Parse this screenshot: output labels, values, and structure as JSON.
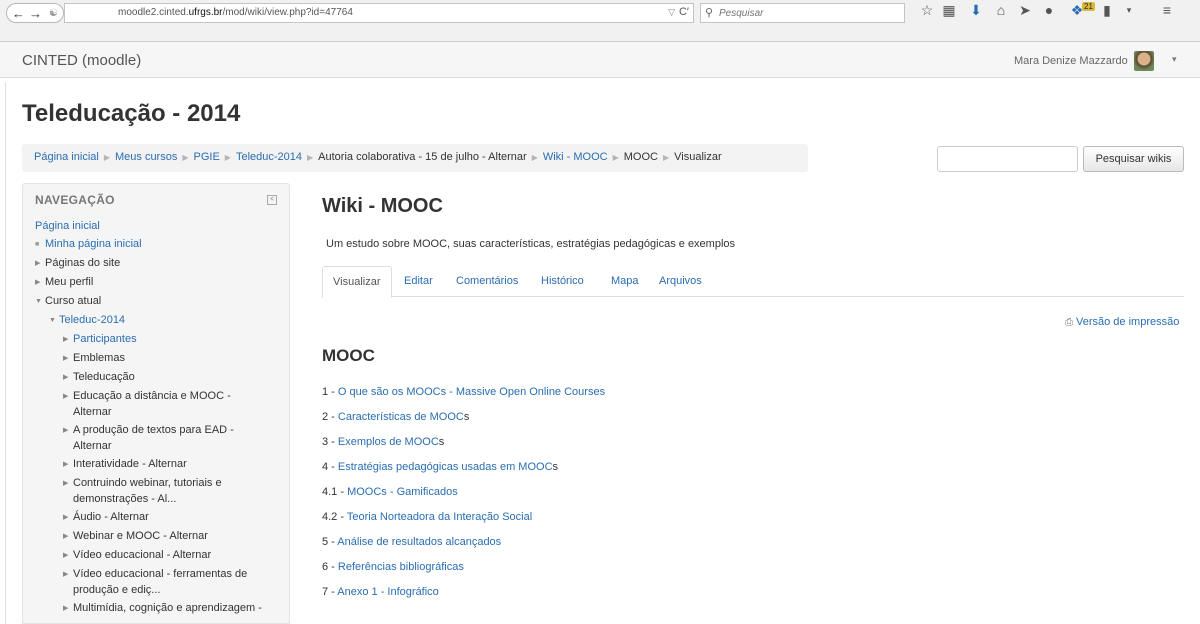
{
  "browser": {
    "url_prefix": "moodle2.cinted.",
    "url_domain": "ufrgs.br",
    "url_path": "/mod/wiki/view.php?id=47764",
    "search_placeholder": "Pesquisar",
    "notification_count": "21"
  },
  "header": {
    "site_name": "CINTED (moodle)",
    "user_name": "Mara Denize Mazzardo"
  },
  "page": {
    "title": "Teleducação - 2014"
  },
  "breadcrumb": [
    {
      "label": "Página inicial",
      "link": true
    },
    {
      "label": "Meus cursos",
      "link": true
    },
    {
      "label": "PGIE",
      "link": true
    },
    {
      "label": "Teleduc-2014",
      "link": true
    },
    {
      "label": "Autoria colaborativa - 15 de julho - Alternar",
      "link": false
    },
    {
      "label": "Wiki - MOOC",
      "link": true
    },
    {
      "label": "MOOC",
      "link": false
    },
    {
      "label": "Visualizar",
      "link": false
    }
  ],
  "wiki_search": {
    "button_label": "Pesquisar wikis"
  },
  "navigation": {
    "title": "NAVEGAÇÃO",
    "items": [
      {
        "label": "Página inicial",
        "level": 0,
        "marker": "none",
        "link": true
      },
      {
        "label": "Minha página inicial",
        "level": 1,
        "marker": "dot",
        "link": true
      },
      {
        "label": "Páginas do site",
        "level": 1,
        "marker": "right",
        "link": false
      },
      {
        "label": "Meu perfil",
        "level": 1,
        "marker": "right",
        "link": false
      },
      {
        "label": "Curso atual",
        "level": 1,
        "marker": "down",
        "link": false
      },
      {
        "label": "Teleduc-2014",
        "level": 2,
        "marker": "down",
        "link": true
      },
      {
        "label": "Participantes",
        "level": 3,
        "marker": "right",
        "link": true
      },
      {
        "label": "Emblemas",
        "level": 3,
        "marker": "right",
        "link": false
      },
      {
        "label": "Teleducação",
        "level": 3,
        "marker": "right",
        "link": false
      },
      {
        "label": "Educação a distância e MOOC - Alternar",
        "level": 3,
        "marker": "right",
        "link": false
      },
      {
        "label": "A produção de textos para EAD - Alternar",
        "level": 3,
        "marker": "right",
        "link": false
      },
      {
        "label": "Interatividade - Alternar",
        "level": 3,
        "marker": "right",
        "link": false
      },
      {
        "label": "Contruindo webinar, tutoriais e demonstrações - Al...",
        "level": 3,
        "marker": "right",
        "link": false
      },
      {
        "label": "Áudio - Alternar",
        "level": 3,
        "marker": "right",
        "link": false
      },
      {
        "label": "Webinar e MOOC - Alternar",
        "level": 3,
        "marker": "right",
        "link": false
      },
      {
        "label": "Vídeo educacional - Alternar",
        "level": 3,
        "marker": "right",
        "link": false
      },
      {
        "label": "Vídeo educacional - ferramentas de produção e ediç...",
        "level": 3,
        "marker": "right",
        "link": false
      },
      {
        "label": "Multimídia, cognição e aprendizagem -",
        "level": 3,
        "marker": "right",
        "link": false
      }
    ]
  },
  "wiki": {
    "title": "Wiki - MOOC",
    "description": "Um estudo sobre MOOC, suas características, estratégias pedagógicas e exemplos",
    "tabs": [
      "Visualizar",
      "Editar",
      "Comentários",
      "Histórico",
      "Mapa",
      "Arquivos"
    ],
    "active_tab": "Visualizar",
    "print_label": "Versão de impressão",
    "section_title": "MOOC",
    "toc": [
      {
        "num": "1 - ",
        "text": "O que são os MOOCs - Massive Open Online Courses",
        "suffix": ""
      },
      {
        "num": "2 - ",
        "text": "Características de MOOC",
        "suffix": "s"
      },
      {
        "num": "3 - ",
        "text": "Exemplos de MOOC",
        "suffix": "s"
      },
      {
        "num": "4 - ",
        "text": "Estratégias pedagógicas usadas em MOOC",
        "suffix": "s"
      },
      {
        "num": "4.1 - ",
        "text": "MOOCs - Gamificados",
        "suffix": ""
      },
      {
        "num": "4.2 - ",
        "text": "Teoria Norteadora da Interação Social",
        "suffix": ""
      },
      {
        "num": "5 - ",
        "text": "Análise de resultados alcançados",
        "suffix": ""
      },
      {
        "num": "6 - ",
        "text": "Referências bibliográficas",
        "suffix": ""
      },
      {
        "num": "7 - ",
        "text": "Anexo 1 - Infográfico",
        "suffix": ""
      }
    ]
  }
}
